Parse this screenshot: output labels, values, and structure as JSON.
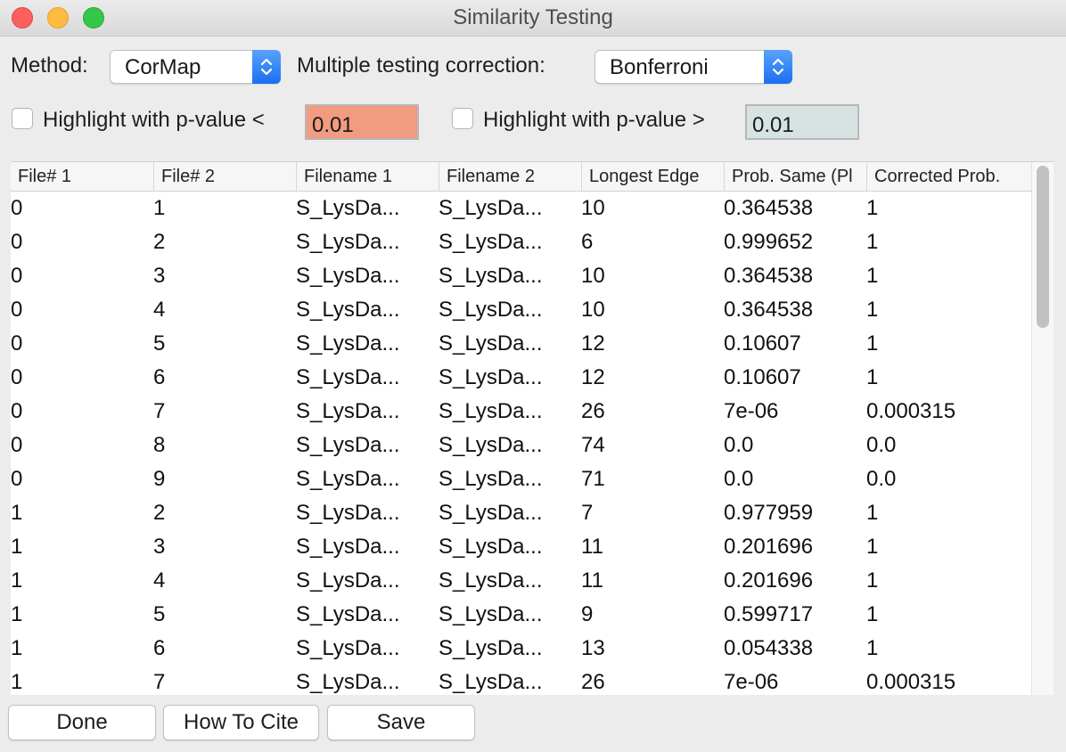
{
  "window": {
    "title": "Similarity Testing"
  },
  "method": {
    "label": "Method:",
    "value": "CorMap"
  },
  "correction": {
    "label": "Multiple testing correction:",
    "value": "Bonferroni"
  },
  "highlight_low": {
    "label": "Highlight with p-value <",
    "value": "0.01",
    "checked": false,
    "color": "#f19b80"
  },
  "highlight_high": {
    "label": "Highlight with p-value >",
    "value": "0.01",
    "checked": false,
    "color": "#d6e3e2"
  },
  "table": {
    "columns": [
      "File# 1",
      "File# 2",
      "Filename 1",
      "Filename 2",
      "Longest Edge",
      "Prob. Same (Pl",
      "Corrected Prob."
    ],
    "rows": [
      [
        "0",
        "1",
        "S_LysDa...",
        "S_LysDa...",
        "10",
        "0.364538",
        "1"
      ],
      [
        "0",
        "2",
        "S_LysDa...",
        "S_LysDa...",
        "6",
        "0.999652",
        "1"
      ],
      [
        "0",
        "3",
        "S_LysDa...",
        "S_LysDa...",
        "10",
        "0.364538",
        "1"
      ],
      [
        "0",
        "4",
        "S_LysDa...",
        "S_LysDa...",
        "10",
        "0.364538",
        "1"
      ],
      [
        "0",
        "5",
        "S_LysDa...",
        "S_LysDa...",
        "12",
        "0.10607",
        "1"
      ],
      [
        "0",
        "6",
        "S_LysDa...",
        "S_LysDa...",
        "12",
        "0.10607",
        "1"
      ],
      [
        "0",
        "7",
        "S_LysDa...",
        "S_LysDa...",
        "26",
        "7e-06",
        "0.000315"
      ],
      [
        "0",
        "8",
        "S_LysDa...",
        "S_LysDa...",
        "74",
        "0.0",
        "0.0"
      ],
      [
        "0",
        "9",
        "S_LysDa...",
        "S_LysDa...",
        "71",
        "0.0",
        "0.0"
      ],
      [
        "1",
        "2",
        "S_LysDa...",
        "S_LysDa...",
        "7",
        "0.977959",
        "1"
      ],
      [
        "1",
        "3",
        "S_LysDa...",
        "S_LysDa...",
        "11",
        "0.201696",
        "1"
      ],
      [
        "1",
        "4",
        "S_LysDa...",
        "S_LysDa...",
        "11",
        "0.201696",
        "1"
      ],
      [
        "1",
        "5",
        "S_LysDa...",
        "S_LysDa...",
        "9",
        "0.599717",
        "1"
      ],
      [
        "1",
        "6",
        "S_LysDa...",
        "S_LysDa...",
        "13",
        "0.054338",
        "1"
      ],
      [
        "1",
        "7",
        "S_LysDa...",
        "S_LysDa...",
        "26",
        "7e-06",
        "0.000315"
      ]
    ]
  },
  "buttons": {
    "done": "Done",
    "cite": "How To Cite",
    "save": "Save"
  }
}
